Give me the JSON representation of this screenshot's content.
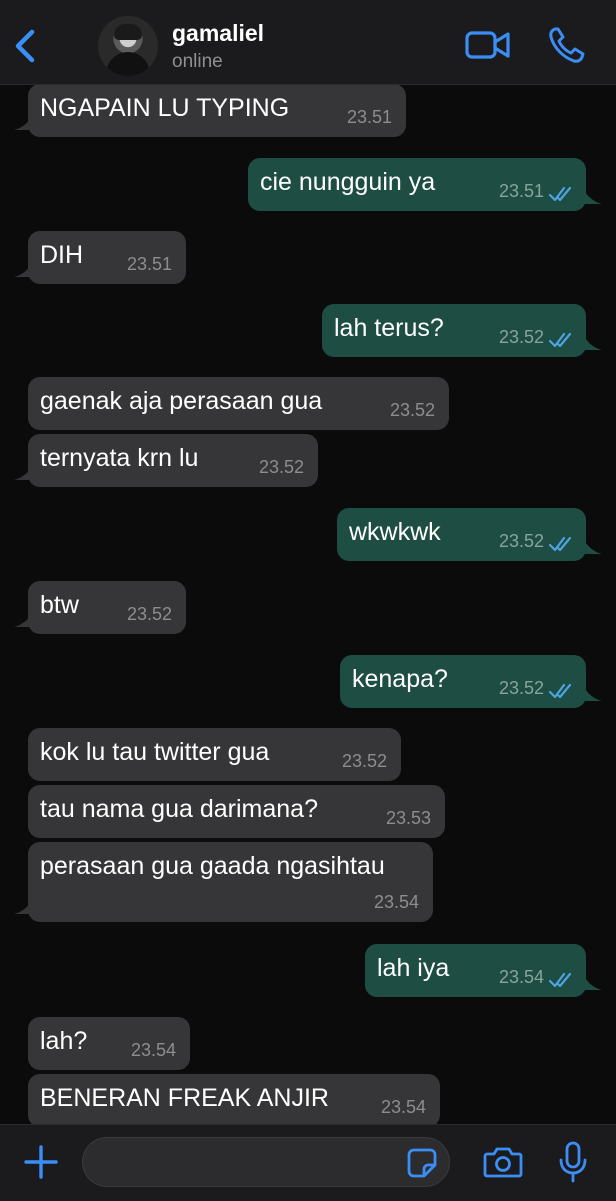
{
  "header": {
    "contact_name": "gamaliel",
    "status": "online",
    "back_icon": "chevron-left-icon",
    "video_icon": "video-camera-icon",
    "call_icon": "phone-icon"
  },
  "colors": {
    "accent": "#3a8ef6",
    "incoming_bubble": "#363638",
    "outgoing_bubble": "#1e4d43",
    "read_ticks": "#4fa3e0"
  },
  "messages": [
    {
      "direction": "in",
      "text": "NGAPAIN LU TYPING",
      "time": "23.51"
    },
    {
      "direction": "out",
      "text": "cie nungguin ya",
      "time": "23.51",
      "status": "read"
    },
    {
      "direction": "in",
      "text": "DIH",
      "time": "23.51"
    },
    {
      "direction": "out",
      "text": "lah terus?",
      "time": "23.52",
      "status": "read"
    },
    {
      "direction": "in",
      "text": "gaenak aja perasaan gua",
      "time": "23.52"
    },
    {
      "direction": "in",
      "text": "ternyata krn lu",
      "time": "23.52"
    },
    {
      "direction": "out",
      "text": "wkwkwk",
      "time": "23.52",
      "status": "read"
    },
    {
      "direction": "in",
      "text": "btw",
      "time": "23.52"
    },
    {
      "direction": "out",
      "text": "kenapa?",
      "time": "23.52",
      "status": "read"
    },
    {
      "direction": "in",
      "text": "kok lu tau twitter gua",
      "time": "23.52"
    },
    {
      "direction": "in",
      "text": "tau nama gua darimana?",
      "time": "23.53"
    },
    {
      "direction": "in",
      "text": "perasaan gua gaada ngasihtau",
      "time": "23.54"
    },
    {
      "direction": "out",
      "text": "lah iya",
      "time": "23.54",
      "status": "read"
    },
    {
      "direction": "in",
      "text": "lah?",
      "time": "23.54"
    },
    {
      "direction": "in",
      "text": "BENERAN FREAK ANJIR",
      "time": "23.54"
    }
  ],
  "input_bar": {
    "message_value": "",
    "plus_icon": "plus-icon",
    "sticker_icon": "sticker-icon",
    "camera_icon": "camera-icon",
    "mic_icon": "microphone-icon"
  }
}
